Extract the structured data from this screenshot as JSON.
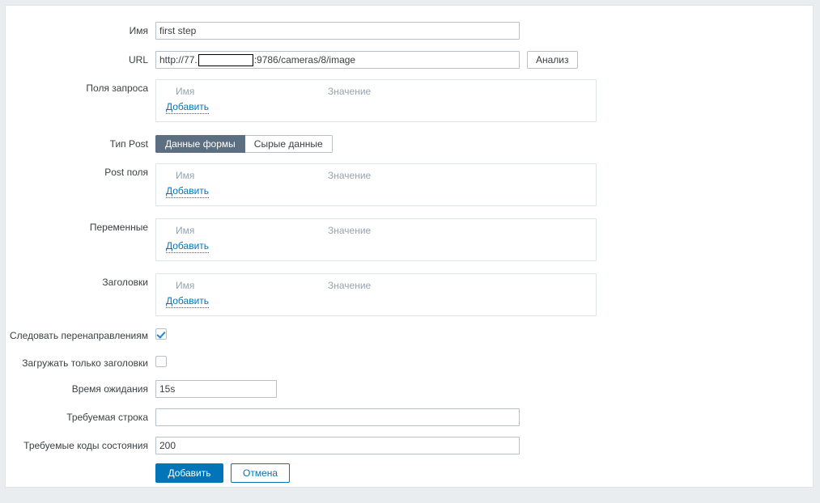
{
  "form": {
    "name": {
      "label": "Имя",
      "value": "first step",
      "placeholder": ""
    },
    "url": {
      "label": "URL",
      "scheme_host": "http://77.",
      "redacted": "",
      "tail": ":9786/cameras/8/image",
      "analyze_button": "Анализ"
    },
    "query_fields": {
      "label": "Поля запроса",
      "col_name": "Имя",
      "col_value": "Значение",
      "add_link": "Добавить"
    },
    "post_type": {
      "label": "Тип Post",
      "options": [
        "Данные формы",
        "Сырые данные"
      ],
      "selected": "Данные формы"
    },
    "post_fields": {
      "label": "Post поля",
      "col_name": "Имя",
      "col_value": "Значение",
      "add_link": "Добавить"
    },
    "variables": {
      "label": "Переменные",
      "col_name": "Имя",
      "col_value": "Значение",
      "add_link": "Добавить"
    },
    "headers": {
      "label": "Заголовки",
      "col_name": "Имя",
      "col_value": "Значение",
      "add_link": "Добавить"
    },
    "follow_redirects": {
      "label": "Следовать перенаправлениям",
      "checked": true
    },
    "retrieve_headers_only": {
      "label": "Загружать только заголовки",
      "checked": false
    },
    "timeout": {
      "label": "Время ожидания",
      "value": "15s",
      "placeholder": ""
    },
    "required_string": {
      "label": "Требуемая строка",
      "value": "",
      "placeholder": ""
    },
    "required_status_codes": {
      "label": "Требуемые коды состояния",
      "value": "200",
      "placeholder": ""
    },
    "actions": {
      "submit": "Добавить",
      "cancel": "Отмена"
    }
  },
  "colors": {
    "page_background": "#e9edf0",
    "panel_background": "#ffffff",
    "accent_blue": "#0275b8",
    "segment_active": "#5c6f81",
    "label_text": "#3c4043",
    "muted_text": "#97a3ad",
    "input_border": "#b6c1c9",
    "box_border": "#dfe4e7",
    "checkmark": "#1d86d0"
  }
}
